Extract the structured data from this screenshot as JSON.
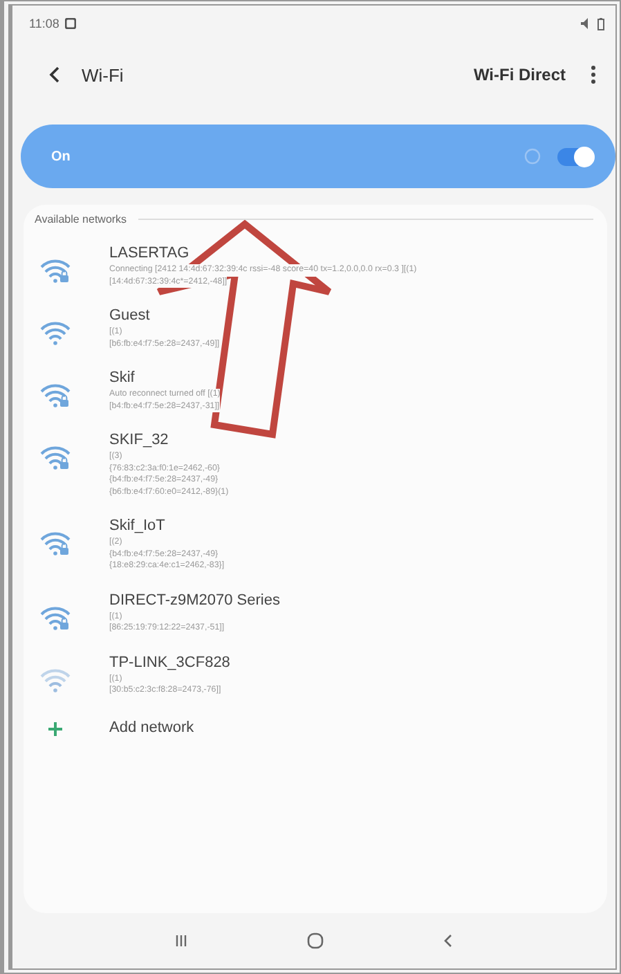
{
  "status_bar": {
    "time": "11:08"
  },
  "header": {
    "title": "Wi-Fi",
    "action": "Wi-Fi Direct"
  },
  "master_switch": {
    "label": "On",
    "on": true
  },
  "section": {
    "title": "Available networks"
  },
  "networks": [
    {
      "name": "LASERTAG",
      "secured": true,
      "details": [
        "Connecting [2412 14:4d:67:32:39:4c rssi=-48 score=40 tx=1.2,0.0,0.0 rx=0.3 ][(1)",
        "[14:4d:67:32:39:4c*=2412,-48]]"
      ]
    },
    {
      "name": "Guest",
      "secured": false,
      "details": [
        "[(1)",
        "[b6:fb:e4:f7:5e:28=2437,-49]]"
      ]
    },
    {
      "name": "Skif",
      "secured": true,
      "details": [
        "Auto reconnect turned off [(1)",
        "[b4:fb:e4:f7:5e:28=2437,-31]]"
      ]
    },
    {
      "name": "SKIF_32",
      "secured": true,
      "details": [
        "[(3)",
        "{76:83:c2:3a:f0:1e=2462,-60}",
        "{b4:fb:e4:f7:5e:28=2437,-49}",
        "{b6:fb:e4:f7:60:e0=2412,-89}(1)"
      ]
    },
    {
      "name": "Skif_IoT",
      "secured": true,
      "details": [
        "[(2)",
        "{b4:fb:e4:f7:5e:28=2437,-49}",
        "{18:e8:29:ca:4e:c1=2462,-83}]"
      ]
    },
    {
      "name": "DIRECT-z9M2070 Series",
      "secured": true,
      "details": [
        "[(1)",
        "[86:25:19:79:12:22=2437,-51]]"
      ]
    },
    {
      "name": "TP-LINK_3CF828",
      "secured": false,
      "details": [
        "[(1)",
        "[30:b5:c2:3c:f8:28=2473,-76]]"
      ]
    }
  ],
  "add_network": {
    "label": "Add network"
  }
}
